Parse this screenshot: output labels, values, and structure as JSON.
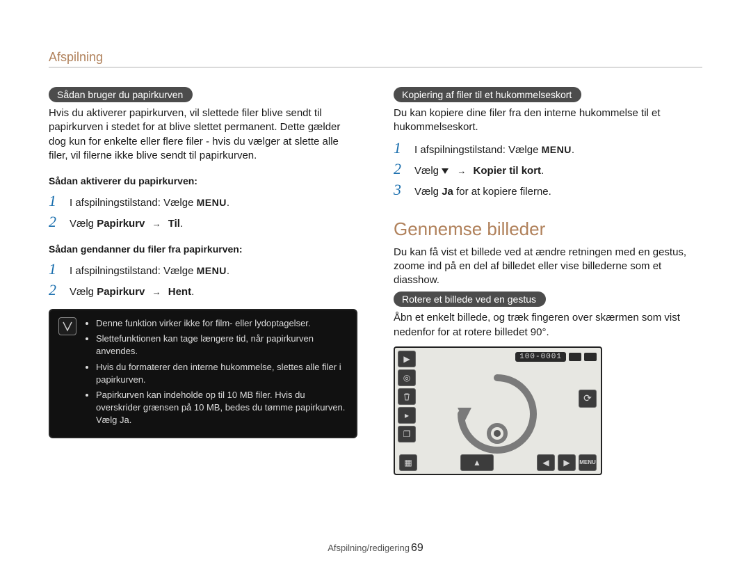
{
  "header": {
    "section": "Afspilning"
  },
  "left": {
    "pill1": "Sådan bruger du papirkurven",
    "intro1": "Hvis du aktiverer papirkurven, vil slettede ﬁler blive sendt til papirkurven i stedet for at blive slettet permanent. Dette gælder dog kun for enkelte eller ﬂere ﬁler - hvis du vælger at slette alle ﬁler, vil ﬁlerne ikke blive sendt til papirkurven.",
    "sub1": "Sådan aktiverer du papirkurven:",
    "step1": {
      "n": "1",
      "text_a": "I afspilningstilstand: Vælge",
      "menu": "MENU",
      "after": "."
    },
    "step2": {
      "n": "2",
      "text": "Vælg",
      "bold1": "Papirkurv",
      "sep": "→",
      "bold2": "Til",
      "after": "."
    },
    "sub2": "Sådan gendanner du ﬁler fra papirkurven:",
    "step3": {
      "n": "1",
      "text_a": "I afspilningstilstand: Vælge",
      "menu": "MENU",
      "after": "."
    },
    "step4": {
      "n": "2",
      "text": "Vælg",
      "bold1": "Papirkurv",
      "sep": "→",
      "bold2": "Hent",
      "after": "."
    },
    "note": {
      "items": [
        "Denne funktion virker ikke for film- eller lydoptagelser.",
        "Slettefunktionen kan tage længere tid, når papirkurven anvendes.",
        "Hvis du formaterer den interne hukommelse, slettes alle ﬁler i papirkurven.",
        "Papirkurven kan indeholde op til 10 MB ﬁler. Hvis du overskrider grænsen på 10 MB, bedes du tømme papirkurven. Vælg Ja."
      ]
    }
  },
  "right": {
    "pill1": "Kopiering af ﬁler til et hukommelseskort",
    "intro1": "Du kan kopiere dine ﬁler fra den interne hukommelse til et hukommelseskort.",
    "step1": {
      "n": "1",
      "text_a": "I afspilningstilstand: Vælge",
      "menu": "MENU",
      "after": "."
    },
    "step2": {
      "n": "2",
      "text": "Vælg",
      "sep": "→",
      "bold": "Kopier til kort",
      "after": "."
    },
    "step3": {
      "n": "3",
      "text_a": "Vælg",
      "bold": "Ja",
      "text_b": "for at kopiere ﬁlerne."
    },
    "h2": "Gennemse billeder",
    "para1": "Du kan få vist et billede ved at ændre retningen med en gestus, zoome ind på en del af billedet eller vise billederne som et diasshow.",
    "pill2": "Rotere et billede ved en gestus",
    "para2": "Åbn et enkelt billede, og træk ﬁngeren over skærmen som vist nedenfor for at rotere billedet 90°.",
    "cam": {
      "counter": "100-0001",
      "icons": {
        "play": "play-icon",
        "target": "target-icon",
        "trash": "trash-icon",
        "slideshow": "slideshow-icon",
        "copy": "copy-icon",
        "grid": "grid-icon",
        "rotate": "rotate-icon",
        "up": "up-icon",
        "left": "left-icon",
        "right": "right-icon",
        "menu": "menu-icon"
      },
      "menu_label": "MENU"
    }
  },
  "footer": {
    "label": "Afspilning/redigering",
    "page": "69"
  }
}
